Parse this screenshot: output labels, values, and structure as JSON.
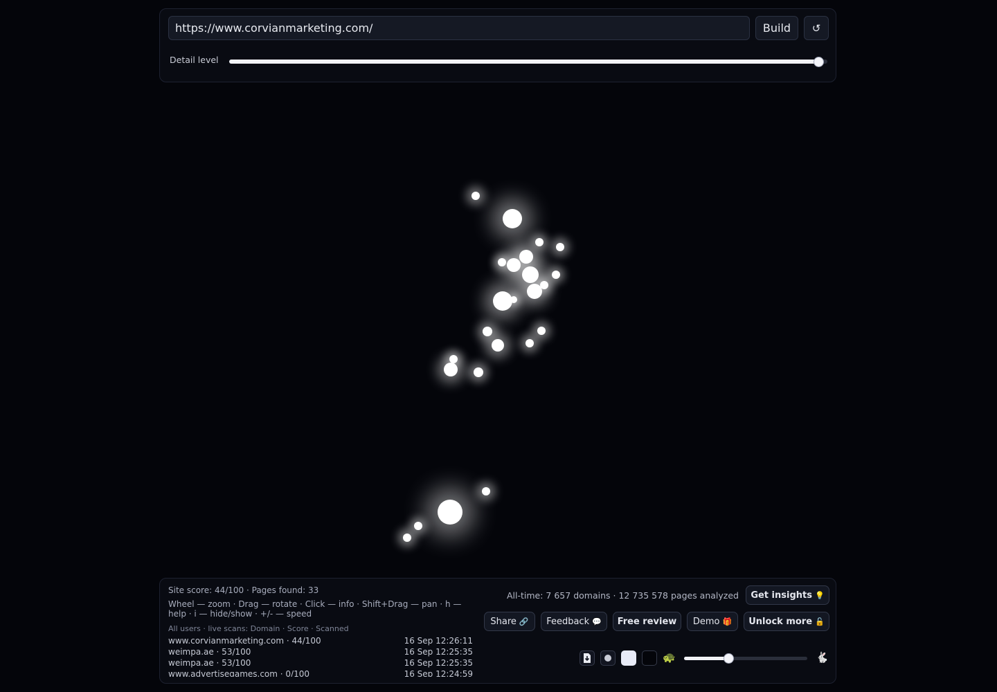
{
  "toolbar": {
    "url_value": "https://www.corvianmarketing.com/",
    "build_label": "Build",
    "reset_icon": "↺",
    "detail_label": "Detail level",
    "detail_level_fraction": 0.985
  },
  "stats": {
    "site_score": "Site score: 44/100 · Pages found: 33",
    "help": "Wheel — zoom · Drag — rotate · Click — info · Shift+Drag — pan · h — help · i — hide/show · +/- — speed",
    "live_header": "All users · live scans: Domain · Score · Scanned",
    "all_time": "All-time: 7 657 domains · 12 735 578 pages analyzed"
  },
  "scans": [
    {
      "domain": "www.corvianmarketing.com · 44/100",
      "time": "16 Sep 12:26:11"
    },
    {
      "domain": "weimpa.ae · 53/100",
      "time": "16 Sep 12:25:35"
    },
    {
      "domain": "weimpa.ae · 53/100",
      "time": "16 Sep 12:25:35"
    },
    {
      "domain": "www.advertisegames.com · 0/100",
      "time": "16 Sep 12:24:59"
    }
  ],
  "actions": {
    "get_insights": "Get insights",
    "get_insights_icon": "💡",
    "share": "Share",
    "share_icon": "🔗",
    "feedback": "Feedback",
    "feedback_icon": "💬",
    "free_review": "Free review",
    "demo": "Demo",
    "demo_icon": "🎁",
    "unlock_more": "Unlock more",
    "unlock_icon": "🔓"
  },
  "controls": {
    "slow_icon": "🐢",
    "fast_icon": "🐇",
    "speed_fraction": 0.36
  },
  "colors": {
    "background": "#04050a",
    "node": "#ffffff",
    "panel": "#090b12"
  }
}
